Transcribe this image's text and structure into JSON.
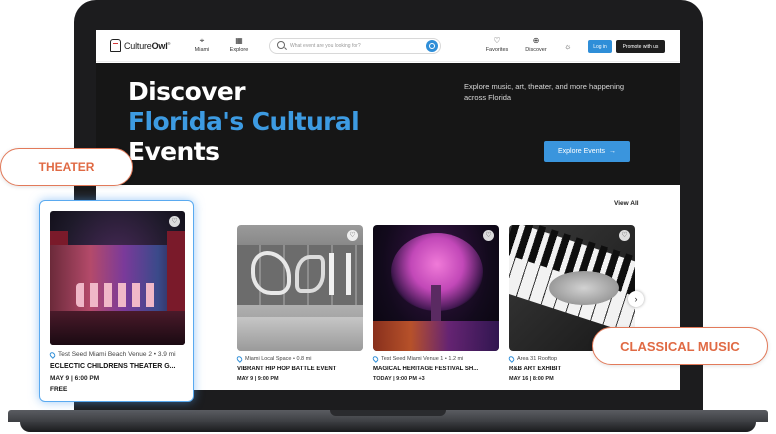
{
  "nav": {
    "logo_prefix": "Culture",
    "logo_bold": "Owl",
    "logo_mark": "®",
    "location_label": "Miami",
    "explore_label": "Explore",
    "search_placeholder": "What event are you looking for?",
    "favorites_label": "Favorites",
    "discover_label": "Discover",
    "login_label": "Log in",
    "promote_label": "Promote with us",
    "icons": [
      "pin-icon",
      "grid-icon",
      "search-icon",
      "heart-icon",
      "globe-icon",
      "sun-icon"
    ]
  },
  "hero": {
    "line1": "Discover",
    "line2": "Florida's Cultural",
    "line3": "Events",
    "subtitle": "Explore music, art, theater, and more happening across Florida",
    "cta_label": "Explore Events",
    "cta_arrow": "→"
  },
  "events": {
    "view_all": "View All",
    "items": [
      {
        "location": "Miami Local Space • 0.8 mi",
        "title": "VIBRANT HIP HOP BATTLE EVENT",
        "date": "MAY 9 | 9:00 PM"
      },
      {
        "location": "Test Seed Miami Venue 1 • 1.2 mi",
        "title": "MAGICAL HERITAGE FESTIVAL SH...",
        "date": "TODAY | 9:00 PM +3"
      },
      {
        "location": "Area 31 Rooftop",
        "title": "R&B ART EXHIBIT",
        "date": "MAY 16 | 8:00 PM"
      }
    ]
  },
  "featured": {
    "location": "Test Seed Miami Beach Venue 2 • 3.9 mi",
    "title": "ECLECTIC CHILDRENS THEATER G...",
    "date": "MAY 9 | 6:00 PM",
    "price": "FREE"
  },
  "tags": {
    "theater": "THEATER",
    "classical": "CLASSICAL MUSIC"
  },
  "colors": {
    "accent_blue": "#3d9be2",
    "tag_orange": "#e06a44",
    "hero_bg": "#161616"
  }
}
